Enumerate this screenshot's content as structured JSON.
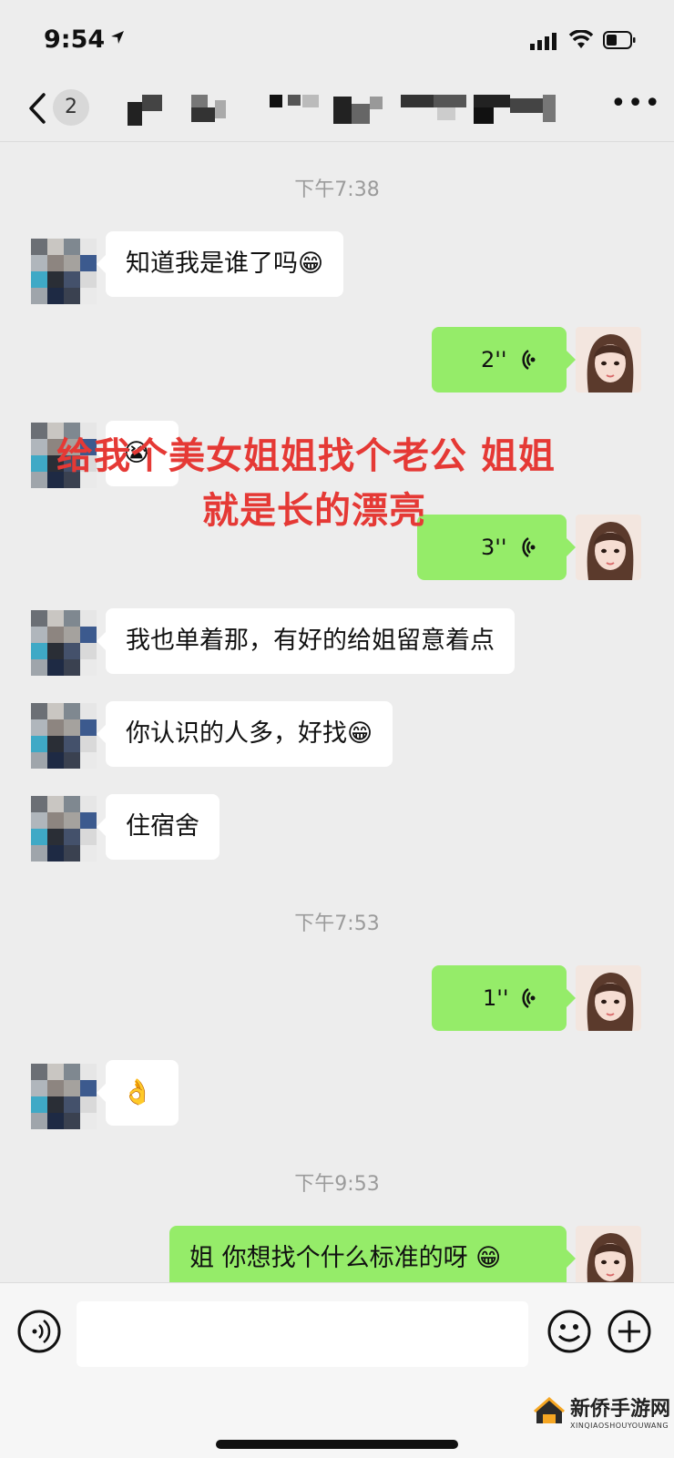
{
  "status_bar": {
    "time": "9:54"
  },
  "nav": {
    "unread_count": "2"
  },
  "messages": [
    {
      "timestamp": "下午7:38"
    },
    {
      "from": "other",
      "text": "知道我是谁了吗😁"
    },
    {
      "from": "me",
      "voice_duration": "2''"
    },
    {
      "from": "other",
      "text": "😭"
    },
    {
      "from": "me",
      "voice_duration": "3''"
    },
    {
      "from": "other",
      "text": "我也单着那，有好的给姐留意着点"
    },
    {
      "from": "other",
      "text": "你认识的人多，好找😁"
    },
    {
      "from": "other",
      "text": "住宿舍"
    },
    {
      "timestamp": "下午7:53"
    },
    {
      "from": "me",
      "voice_duration": "1''"
    },
    {
      "from": "other",
      "text": "👌"
    },
    {
      "timestamp": "下午9:53"
    },
    {
      "from": "me",
      "text": "姐 你想找个什么标准的呀 😁"
    }
  ],
  "overlay_caption": {
    "line1": "给我个美女姐姐找个老公  姐姐",
    "line2": "就是长的漂亮",
    "color": "#e53935"
  },
  "input_bar": {
    "text_value": ""
  },
  "watermark": {
    "title": "新侨手游网",
    "subtitle": "XINQIAOSHOUYOUWANG"
  },
  "colors": {
    "outgoing_bubble": "#95ec69",
    "incoming_bubble": "#ffffff",
    "background": "#ededed"
  }
}
